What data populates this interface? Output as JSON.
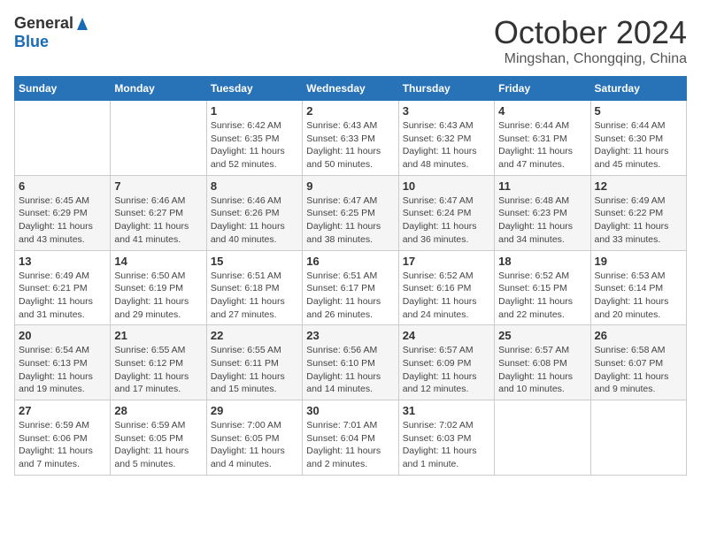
{
  "header": {
    "logo_general": "General",
    "logo_blue": "Blue",
    "month_title": "October 2024",
    "location": "Mingshan, Chongqing, China"
  },
  "days_of_week": [
    "Sunday",
    "Monday",
    "Tuesday",
    "Wednesday",
    "Thursday",
    "Friday",
    "Saturday"
  ],
  "weeks": [
    [
      {
        "day": "",
        "info": ""
      },
      {
        "day": "",
        "info": ""
      },
      {
        "day": "1",
        "info": "Sunrise: 6:42 AM\nSunset: 6:35 PM\nDaylight: 11 hours and 52 minutes."
      },
      {
        "day": "2",
        "info": "Sunrise: 6:43 AM\nSunset: 6:33 PM\nDaylight: 11 hours and 50 minutes."
      },
      {
        "day": "3",
        "info": "Sunrise: 6:43 AM\nSunset: 6:32 PM\nDaylight: 11 hours and 48 minutes."
      },
      {
        "day": "4",
        "info": "Sunrise: 6:44 AM\nSunset: 6:31 PM\nDaylight: 11 hours and 47 minutes."
      },
      {
        "day": "5",
        "info": "Sunrise: 6:44 AM\nSunset: 6:30 PM\nDaylight: 11 hours and 45 minutes."
      }
    ],
    [
      {
        "day": "6",
        "info": "Sunrise: 6:45 AM\nSunset: 6:29 PM\nDaylight: 11 hours and 43 minutes."
      },
      {
        "day": "7",
        "info": "Sunrise: 6:46 AM\nSunset: 6:27 PM\nDaylight: 11 hours and 41 minutes."
      },
      {
        "day": "8",
        "info": "Sunrise: 6:46 AM\nSunset: 6:26 PM\nDaylight: 11 hours and 40 minutes."
      },
      {
        "day": "9",
        "info": "Sunrise: 6:47 AM\nSunset: 6:25 PM\nDaylight: 11 hours and 38 minutes."
      },
      {
        "day": "10",
        "info": "Sunrise: 6:47 AM\nSunset: 6:24 PM\nDaylight: 11 hours and 36 minutes."
      },
      {
        "day": "11",
        "info": "Sunrise: 6:48 AM\nSunset: 6:23 PM\nDaylight: 11 hours and 34 minutes."
      },
      {
        "day": "12",
        "info": "Sunrise: 6:49 AM\nSunset: 6:22 PM\nDaylight: 11 hours and 33 minutes."
      }
    ],
    [
      {
        "day": "13",
        "info": "Sunrise: 6:49 AM\nSunset: 6:21 PM\nDaylight: 11 hours and 31 minutes."
      },
      {
        "day": "14",
        "info": "Sunrise: 6:50 AM\nSunset: 6:19 PM\nDaylight: 11 hours and 29 minutes."
      },
      {
        "day": "15",
        "info": "Sunrise: 6:51 AM\nSunset: 6:18 PM\nDaylight: 11 hours and 27 minutes."
      },
      {
        "day": "16",
        "info": "Sunrise: 6:51 AM\nSunset: 6:17 PM\nDaylight: 11 hours and 26 minutes."
      },
      {
        "day": "17",
        "info": "Sunrise: 6:52 AM\nSunset: 6:16 PM\nDaylight: 11 hours and 24 minutes."
      },
      {
        "day": "18",
        "info": "Sunrise: 6:52 AM\nSunset: 6:15 PM\nDaylight: 11 hours and 22 minutes."
      },
      {
        "day": "19",
        "info": "Sunrise: 6:53 AM\nSunset: 6:14 PM\nDaylight: 11 hours and 20 minutes."
      }
    ],
    [
      {
        "day": "20",
        "info": "Sunrise: 6:54 AM\nSunset: 6:13 PM\nDaylight: 11 hours and 19 minutes."
      },
      {
        "day": "21",
        "info": "Sunrise: 6:55 AM\nSunset: 6:12 PM\nDaylight: 11 hours and 17 minutes."
      },
      {
        "day": "22",
        "info": "Sunrise: 6:55 AM\nSunset: 6:11 PM\nDaylight: 11 hours and 15 minutes."
      },
      {
        "day": "23",
        "info": "Sunrise: 6:56 AM\nSunset: 6:10 PM\nDaylight: 11 hours and 14 minutes."
      },
      {
        "day": "24",
        "info": "Sunrise: 6:57 AM\nSunset: 6:09 PM\nDaylight: 11 hours and 12 minutes."
      },
      {
        "day": "25",
        "info": "Sunrise: 6:57 AM\nSunset: 6:08 PM\nDaylight: 11 hours and 10 minutes."
      },
      {
        "day": "26",
        "info": "Sunrise: 6:58 AM\nSunset: 6:07 PM\nDaylight: 11 hours and 9 minutes."
      }
    ],
    [
      {
        "day": "27",
        "info": "Sunrise: 6:59 AM\nSunset: 6:06 PM\nDaylight: 11 hours and 7 minutes."
      },
      {
        "day": "28",
        "info": "Sunrise: 6:59 AM\nSunset: 6:05 PM\nDaylight: 11 hours and 5 minutes."
      },
      {
        "day": "29",
        "info": "Sunrise: 7:00 AM\nSunset: 6:05 PM\nDaylight: 11 hours and 4 minutes."
      },
      {
        "day": "30",
        "info": "Sunrise: 7:01 AM\nSunset: 6:04 PM\nDaylight: 11 hours and 2 minutes."
      },
      {
        "day": "31",
        "info": "Sunrise: 7:02 AM\nSunset: 6:03 PM\nDaylight: 11 hours and 1 minute."
      },
      {
        "day": "",
        "info": ""
      },
      {
        "day": "",
        "info": ""
      }
    ]
  ]
}
